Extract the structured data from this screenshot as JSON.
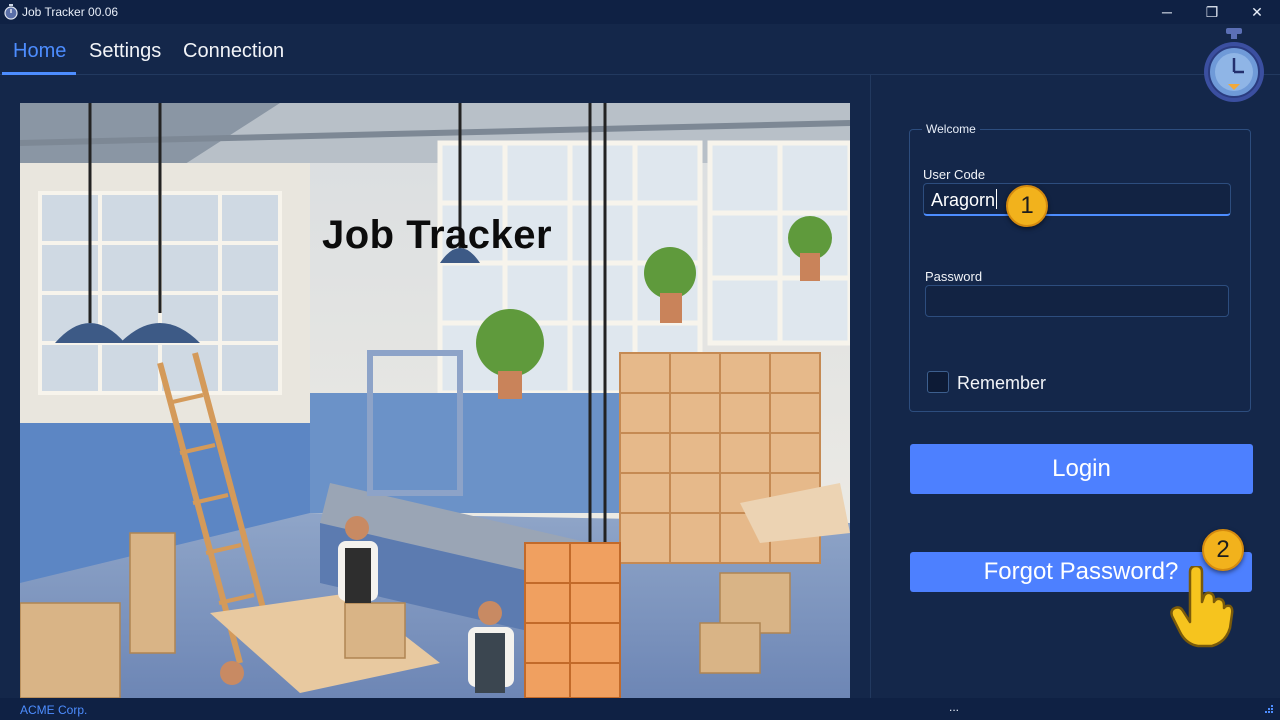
{
  "window": {
    "title": "Job Tracker 00.06",
    "minimize_icon": "minimize-icon",
    "maximize_icon": "restore-icon",
    "close_icon": "close-icon",
    "min_glyph": "─",
    "max_glyph": "❐",
    "close_glyph": "✕"
  },
  "tabs": [
    {
      "label": "Home",
      "active": true
    },
    {
      "label": "Settings",
      "active": false
    },
    {
      "label": "Connection",
      "active": false
    }
  ],
  "hero": {
    "title": "Job Tracker"
  },
  "login": {
    "group_title": "Welcome",
    "user_code_label": "User Code",
    "user_code_value": "Aragorn",
    "password_label": "Password",
    "password_value": "",
    "remember_label": "Remember",
    "remember_checked": false,
    "login_button": "Login",
    "forgot_button": "Forgot Password?"
  },
  "annotations": {
    "step1": "1",
    "step2": "2"
  },
  "status": {
    "company": "ACME Corp.",
    "indicator": "..."
  },
  "colors": {
    "background": "#14274a",
    "accent": "#4d80ff",
    "active_tab": "#4d8dff",
    "badge": "#f2b21c"
  }
}
